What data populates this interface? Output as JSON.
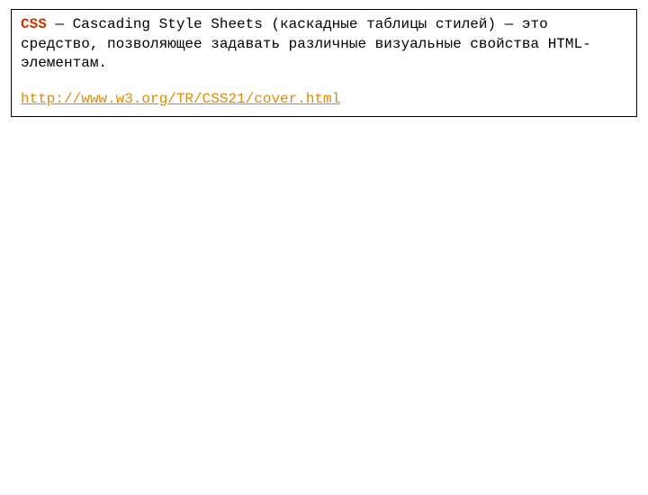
{
  "definition": {
    "term": "CSS",
    "text": " — Cascading Style Sheets (каскадные таблицы стилей) — это средство, позволяющее задавать различные визуальные свойства HTML-элементам."
  },
  "link": {
    "url_text": "http://www.w3.org/TR/CSS21/cover.html"
  }
}
